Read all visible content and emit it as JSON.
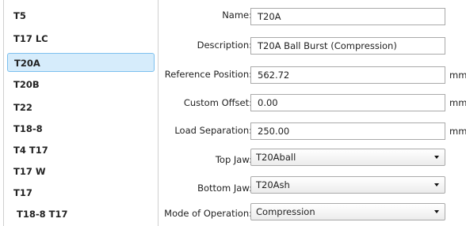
{
  "list": {
    "items": [
      {
        "label": "T5"
      },
      {
        "label": "T17 LC"
      },
      {
        "label": "T20A"
      },
      {
        "label": "T20B"
      },
      {
        "label": "T22"
      },
      {
        "label": "T18-8"
      },
      {
        "label": "T4 T17"
      },
      {
        "label": "T17 W"
      },
      {
        "label": "T17"
      },
      {
        "label": "T18-8 T17"
      }
    ],
    "selected": "T20A"
  },
  "form": {
    "name": {
      "label": "Name:",
      "value": "T20A"
    },
    "description": {
      "label": "Description:",
      "value": "T20A Ball Burst (Compression)"
    },
    "reference_position": {
      "label": "Reference Position:",
      "value": "562.72",
      "unit": "mm"
    },
    "custom_offset": {
      "label": "Custom Offset:",
      "value": "0.00",
      "unit": "mm"
    },
    "load_separation": {
      "label": "Load Separation:",
      "value": "250.00",
      "unit": "mm"
    },
    "top_jaw": {
      "label": "Top Jaw:",
      "value": "T20Aball"
    },
    "bottom_jaw": {
      "label": "Bottom Jaw:",
      "value": "T20Ash"
    },
    "mode_of_operation": {
      "label": "Mode of Operation:",
      "value": "Compression"
    }
  },
  "colors": {
    "selection_bg": "#d6ecfb",
    "selection_border": "#7cc0ef"
  }
}
